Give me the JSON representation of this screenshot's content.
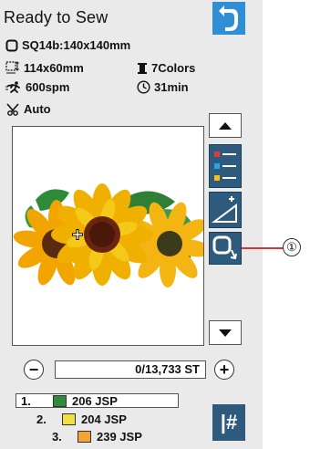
{
  "header": {
    "title": "Ready to Sew"
  },
  "info": {
    "hoop": "SQ14b:140x140mm",
    "size": "114x60mm",
    "colors": "7Colors",
    "speed": "600spm",
    "time": "31min",
    "thread_cut": "Auto"
  },
  "stitch": {
    "counter": "0/13,733 ST",
    "minus": "−",
    "plus": "+"
  },
  "color_list": [
    {
      "num": "1.",
      "label": "206 JSP",
      "color": "#2f8a3a",
      "selected": true
    },
    {
      "num": "2.",
      "label": "204 JSP",
      "color": "#f0e040",
      "selected": false
    },
    {
      "num": "3.",
      "label": "239 JSP",
      "color": "#f2a532",
      "selected": false
    }
  ],
  "buttons": {
    "jump": "|#"
  },
  "callout": {
    "label": "①"
  },
  "colors": {
    "accent_blue": "#2f8fd6",
    "tool_blue": "#2e5a7e",
    "callout_red": "#e03030"
  }
}
